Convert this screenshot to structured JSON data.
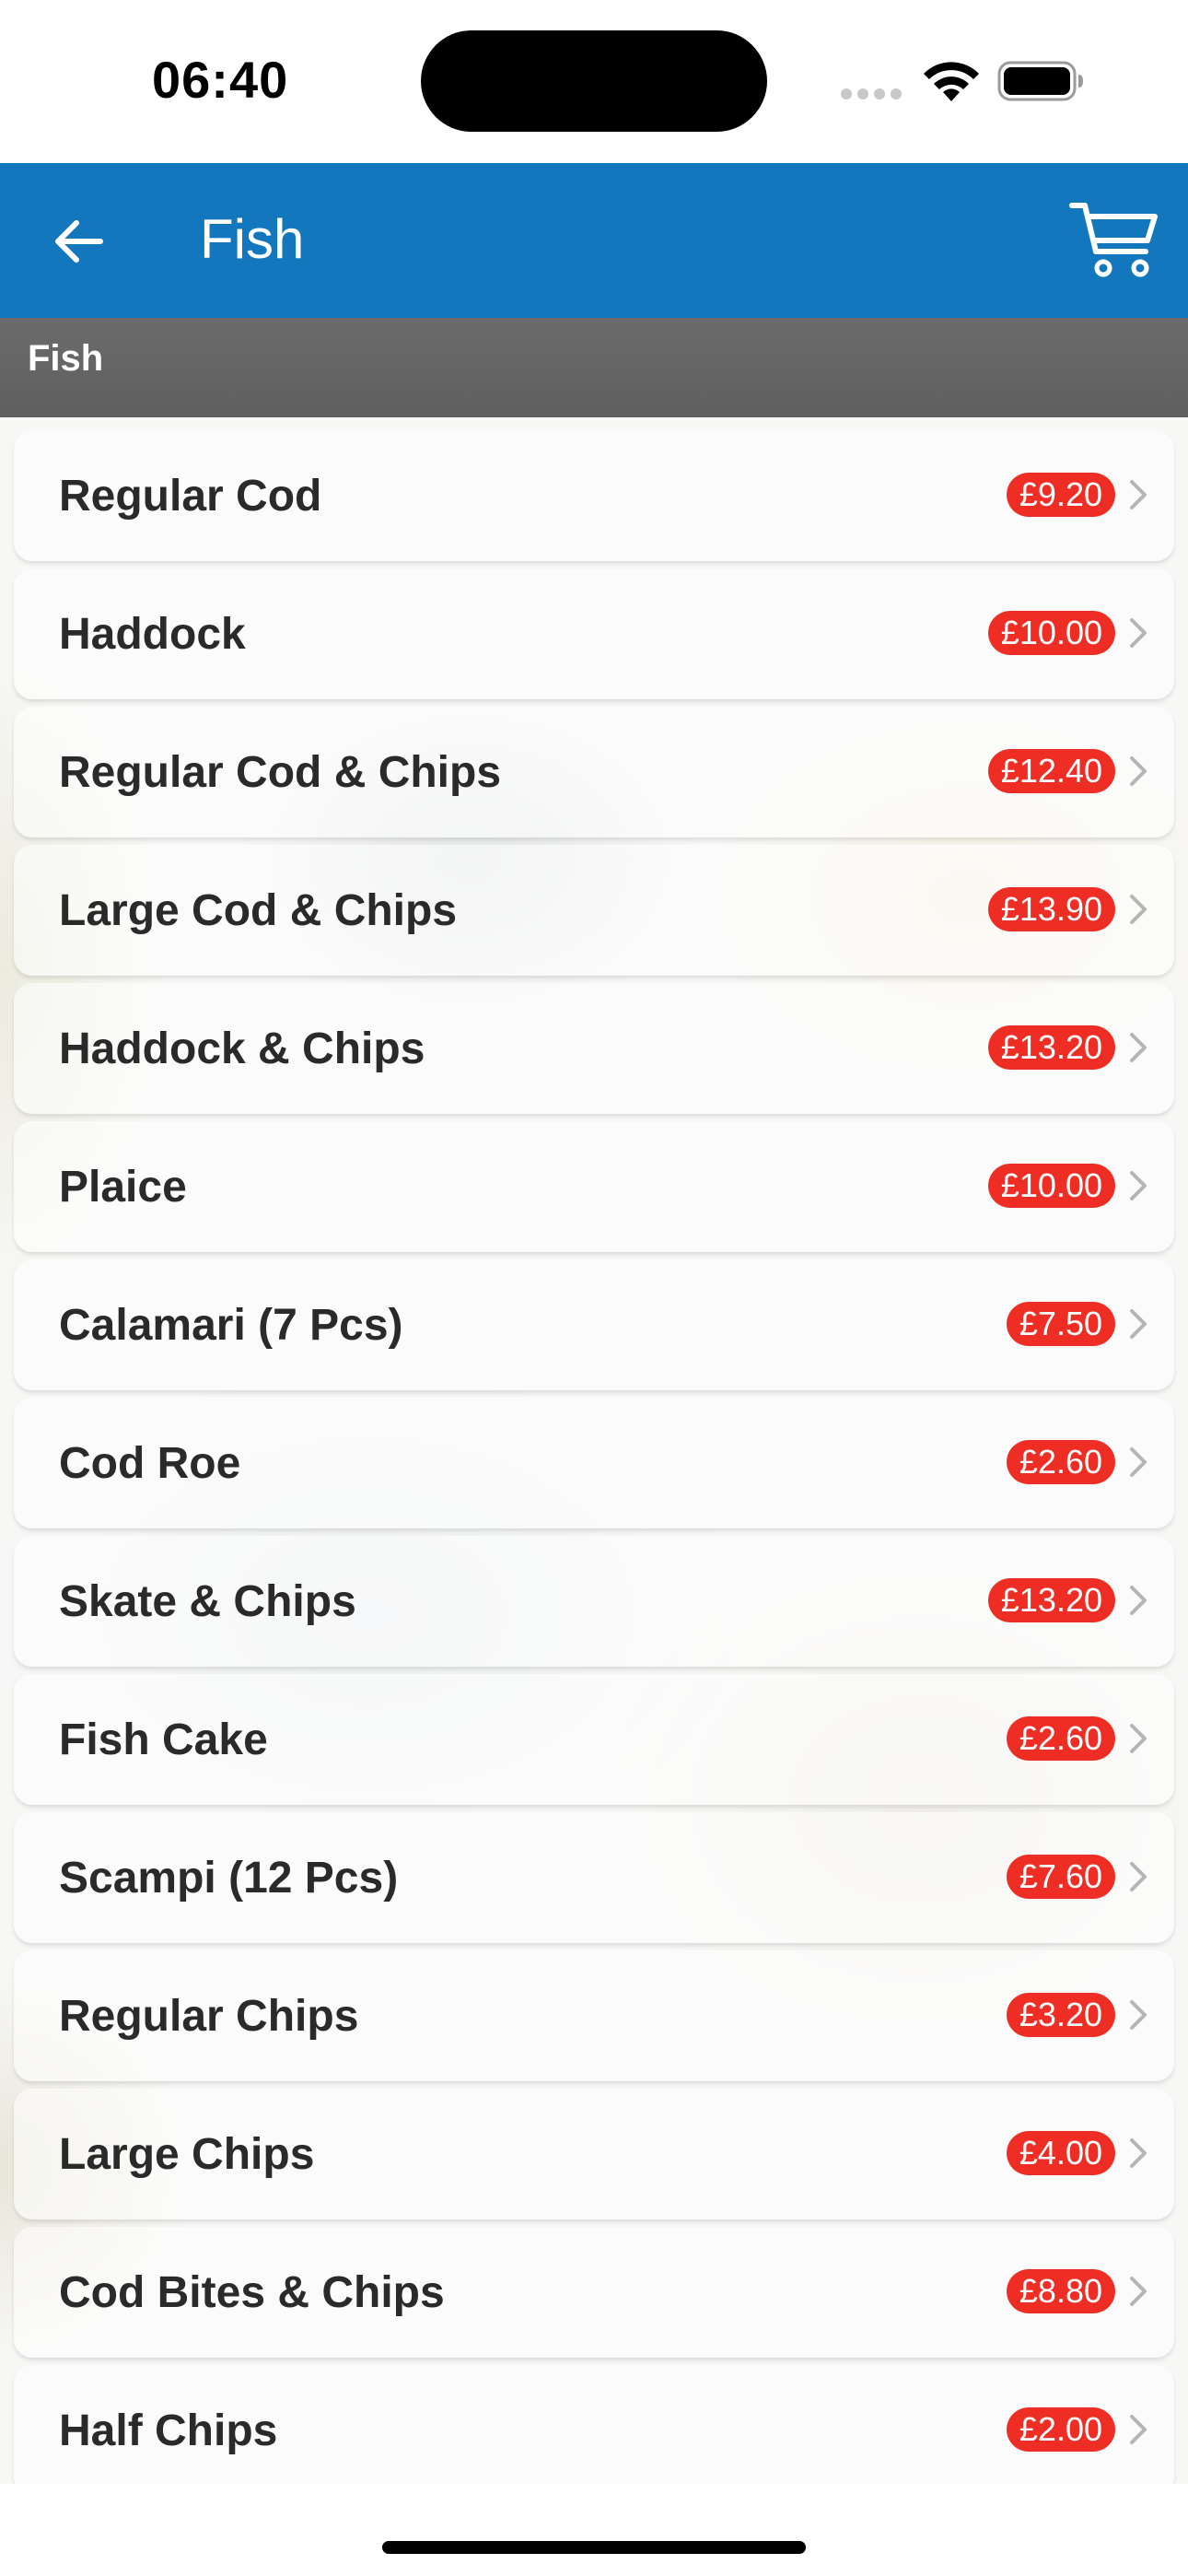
{
  "status_bar": {
    "time": "06:40"
  },
  "nav": {
    "title": "Fish",
    "back_icon": "arrow-left-icon",
    "cart_icon": "shopping-cart-icon",
    "color": "#1277bd"
  },
  "section": {
    "title": "Fish"
  },
  "colors": {
    "price_badge": "#ee2e24",
    "section_header": "#666666"
  },
  "menu": {
    "items": [
      {
        "name": "Regular Cod",
        "price": "£9.20"
      },
      {
        "name": "Haddock",
        "price": "£10.00"
      },
      {
        "name": "Regular Cod & Chips",
        "price": "£12.40"
      },
      {
        "name": "Large Cod & Chips",
        "price": "£13.90"
      },
      {
        "name": "Haddock & Chips",
        "price": "£13.20"
      },
      {
        "name": "Plaice",
        "price": "£10.00"
      },
      {
        "name": "Calamari (7 Pcs)",
        "price": "£7.50"
      },
      {
        "name": "Cod Roe",
        "price": "£2.60"
      },
      {
        "name": "Skate & Chips",
        "price": "£13.20"
      },
      {
        "name": "Fish Cake",
        "price": "£2.60"
      },
      {
        "name": "Scampi (12 Pcs)",
        "price": "£7.60"
      },
      {
        "name": "Regular Chips",
        "price": "£3.20"
      },
      {
        "name": "Large Chips",
        "price": "£4.00"
      },
      {
        "name": "Cod Bites & Chips",
        "price": "£8.80"
      },
      {
        "name": "Half Chips",
        "price": "£2.00"
      }
    ]
  }
}
